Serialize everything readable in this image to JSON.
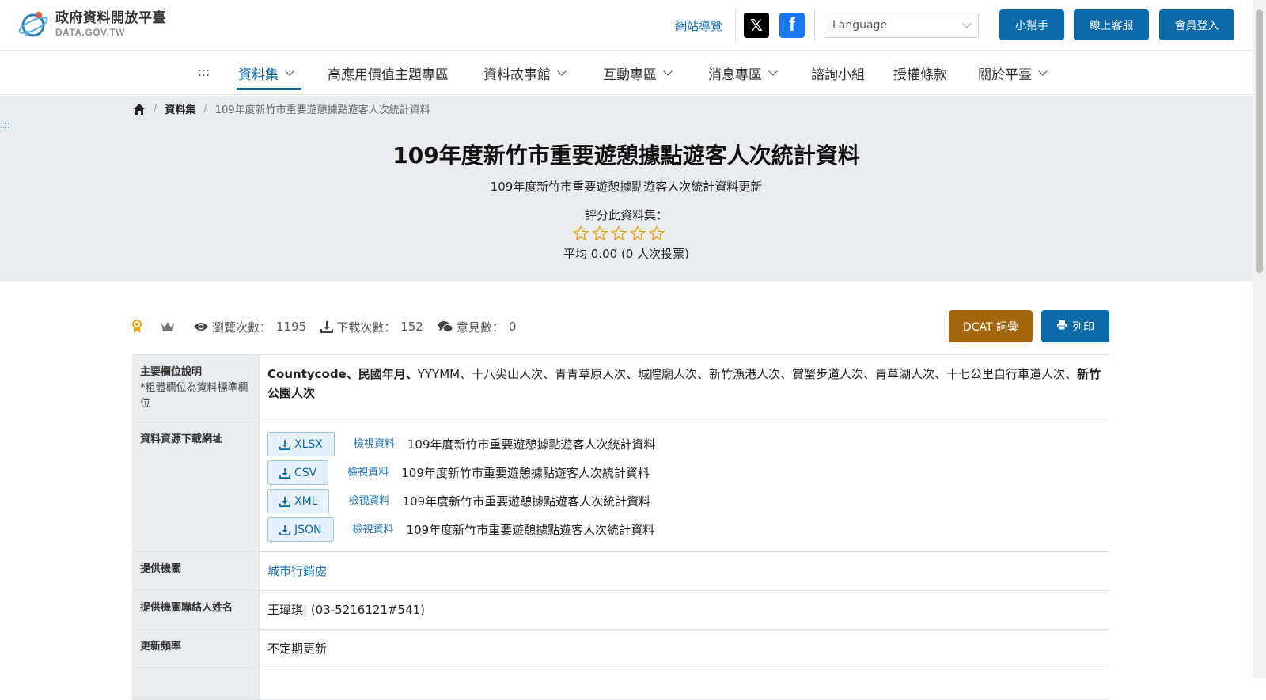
{
  "header": {
    "logo_title": "政府資料開放平臺",
    "logo_sub": "DATA.GOV.TW",
    "sitemap": "網站導覽",
    "social_x": "𝕏",
    "social_fb": "f",
    "language_placeholder": "Language",
    "buttons": {
      "helper": "小幫手",
      "support": "線上客服",
      "login": "會員登入"
    }
  },
  "nav": {
    "dots": ":::",
    "items": [
      {
        "label": "資料集"
      },
      {
        "label": "高應用價值主題專區"
      },
      {
        "label": "資料故事館"
      },
      {
        "label": "互動專區"
      },
      {
        "label": "消息專區"
      },
      {
        "label": "諮詢小組"
      },
      {
        "label": "授權條款"
      },
      {
        "label": "關於平臺"
      }
    ]
  },
  "breadcrumb": {
    "level1": "資料集",
    "current": "109年度新竹市重要遊憩據點遊客人次統計資料"
  },
  "hero": {
    "skip": ":::",
    "title": "109年度新竹市重要遊憩據點遊客人次統計資料",
    "description": "109年度新竹市重要遊憩據點遊客人次統計資料更新",
    "rate_label": "評分此資料集：",
    "rating": 0,
    "max_rating": 5,
    "average": "平均 0.00 (0 人次投票)"
  },
  "stats": {
    "views_label": "瀏覽次數：",
    "views": "1195",
    "downloads_label": "下載次數：",
    "downloads": "152",
    "comments_label": "意見數：",
    "comments": "0",
    "dcat_button": "DCAT 詞彙",
    "print_button": "列印"
  },
  "details": {
    "fields_label": "主要欄位說明",
    "fields_note": "*粗體欄位為資料標準欄位",
    "fields_bold_lead": "Countycode、民國年月、",
    "fields_plain": "YYYMM、十八尖山人次、青青草原人次、城隍廟人次、新竹漁港人次、賞蟹步道人次、青草湖人次、十七公里自行車道人次、",
    "fields_bold_tail": "新竹公園人次",
    "resources_label": "資料資源下載網址",
    "resources": [
      {
        "format": "XLSX",
        "view": "檢視資料",
        "name": "109年度新竹市重要遊憩據點遊客人次統計資料"
      },
      {
        "format": "CSV",
        "view": "檢視資料",
        "name": "109年度新竹市重要遊憩據點遊客人次統計資料"
      },
      {
        "format": "XML",
        "view": "檢視資料",
        "name": "109年度新竹市重要遊憩據點遊客人次統計資料"
      },
      {
        "format": "JSON",
        "view": "檢視資料",
        "name": "109年度新竹市重要遊憩據點遊客人次統計資料"
      }
    ],
    "provider_label": "提供機關",
    "provider": "城市行銷處",
    "contact_label": "提供機關聯絡人姓名",
    "contact": "王瑋琪| (03-5216121#541)",
    "frequency_label": "更新頻率",
    "frequency": "不定期更新"
  },
  "colors": {
    "primary": "#0b6aa8",
    "dcat": "#a3670e",
    "hero_bg": "#e8ecf1",
    "star": "#e8a317"
  }
}
